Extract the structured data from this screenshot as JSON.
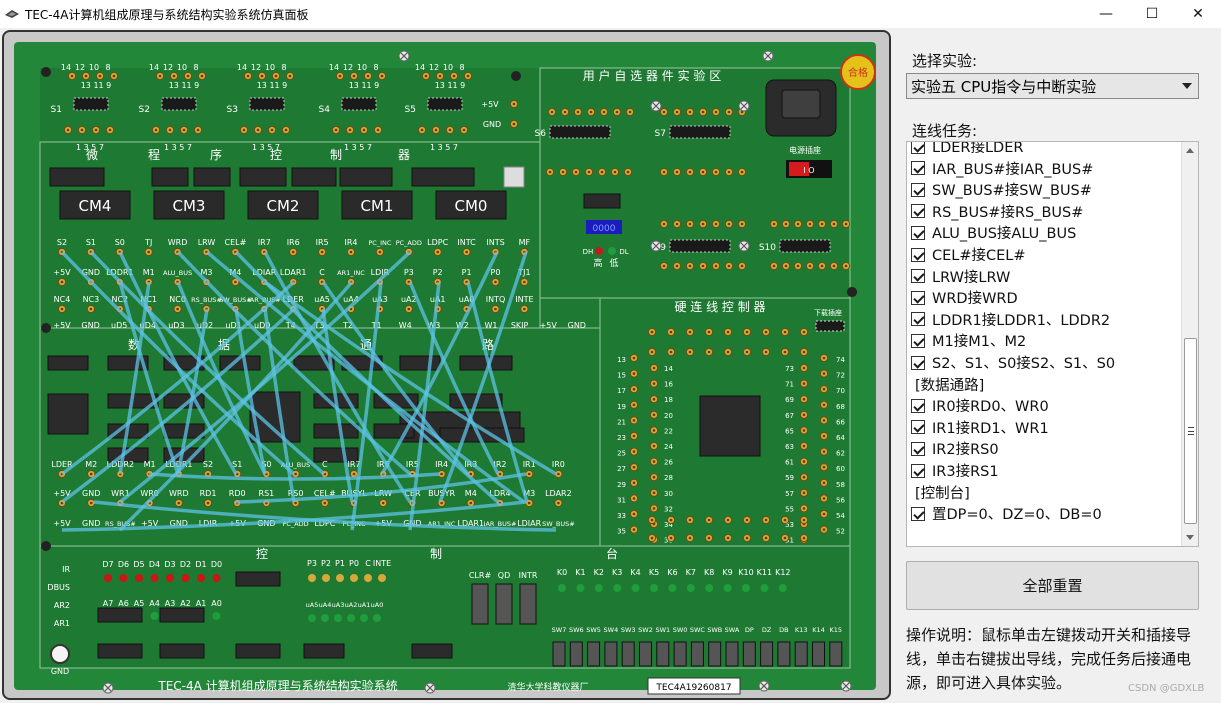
{
  "window": {
    "title": "TEC-4A计算机组成原理与系统结构实验系统仿真面板",
    "minimize": "—",
    "maximize": "☐",
    "close": "✕"
  },
  "panel": {
    "experiment_label": "选择实验:",
    "experiment_selected": "实验五  CPU指令与中断实验",
    "tasks_label": "连线任务:",
    "tasks": [
      {
        "text": "LDER接LDER",
        "checked": true
      },
      {
        "text": "IAR_BUS#接IAR_BUS#",
        "checked": true
      },
      {
        "text": "SW_BUS#接SW_BUS#",
        "checked": true
      },
      {
        "text": "RS_BUS#接RS_BUS#",
        "checked": true
      },
      {
        "text": "ALU_BUS接ALU_BUS",
        "checked": true
      },
      {
        "text": "CEL#接CEL#",
        "checked": true
      },
      {
        "text": "LRW接LRW",
        "checked": true
      },
      {
        "text": "WRD接WRD",
        "checked": true
      },
      {
        "text": "LDDR1接LDDR1、LDDR2",
        "checked": true
      },
      {
        "text": "M1接M1、M2",
        "checked": true
      },
      {
        "text": "S2、S1、S0接S2、S1、S0",
        "checked": true
      },
      {
        "header": "[数据通路]"
      },
      {
        "text": "IR0接RD0、WR0",
        "checked": true
      },
      {
        "text": "IR1接RD1、WR1",
        "checked": true
      },
      {
        "text": "IR2接RS0",
        "checked": true
      },
      {
        "text": "IR3接RS1",
        "checked": true
      },
      {
        "header": "[控制台]"
      },
      {
        "text": "置DP=0、DZ=0、DB=0",
        "checked": true
      }
    ],
    "reset_label": "全部重置",
    "help_text": "操作说明：鼠标单击左键拨动开关和插接导线，单击右键拔出导线，完成任务后接通电源，即可进入具体实验。"
  },
  "board": {
    "cm_labels": [
      "CM4",
      "CM3",
      "CM2",
      "CM1",
      "CM0"
    ],
    "section_micro": [
      "微",
      "程",
      "序",
      "控",
      "制",
      "器"
    ],
    "section_data": [
      "数",
      "据",
      "通",
      "路"
    ],
    "section_control": [
      "控",
      "制",
      "台"
    ],
    "section_user": "用 户 自 选 器 件 实 验 区",
    "section_hardwire": "硬 连 线 控 制 器",
    "pass_badge": "合格",
    "power_label": "电源插座",
    "download_label": "下载插座",
    "switch_labels": [
      "S1",
      "S2",
      "S3",
      "S4",
      "S5",
      "S6",
      "S7",
      "S8",
      "S9",
      "S10"
    ],
    "micro_sig_row1": [
      "S2",
      "S1",
      "S0",
      "TJ",
      "WRD",
      "LRW",
      "CEL#",
      "IR7",
      "IR6",
      "IR5",
      "IR4",
      "PC_INC",
      "PC_ADD",
      "LDPC",
      "INTC",
      "INTS",
      "MF"
    ],
    "micro_sig_row2": [
      "+5V",
      "GND",
      "LDDR1",
      "M1",
      "ALU_BUS",
      "M3",
      "M4",
      "LDIAR",
      "LDAR1",
      "C",
      "AR1_INC",
      "LDIR",
      "P3",
      "P2",
      "P1",
      "P0",
      "TJ1"
    ],
    "micro_sig_row3": [
      "NC4",
      "NC3",
      "NC2",
      "NC1",
      "NC0",
      "RS_BUS#",
      "SW_BUS#",
      "IAR_BUS#",
      "LDER",
      "uA5",
      "uA4",
      "uA3",
      "uA2",
      "uA1",
      "uA0",
      "INTQ",
      "INTE"
    ],
    "micro_sig_row4": [
      "+5V",
      "GND",
      "uD5",
      "uD4",
      "uD3",
      "uD2",
      "uD1",
      "uD0",
      "T4",
      "T3",
      "T2",
      "T1",
      "W4",
      "W3",
      "W2",
      "W1",
      "SKIP",
      "+5V",
      "GND"
    ],
    "data_sig_row1": [
      "LDER",
      "M2",
      "LDDR2",
      "M1",
      "LDDR1",
      "S2",
      "S1",
      "S0",
      "ALU_BUS",
      "C",
      "IR7",
      "IR6",
      "IR5",
      "IR4",
      "IR3",
      "IR2",
      "IR1",
      "IR0"
    ],
    "data_sig_row2": [
      "+5V",
      "GND",
      "WR1",
      "WR0",
      "WRD",
      "RD1",
      "RD0",
      "RS1",
      "RS0",
      "CEL#",
      "BUSYL",
      "LRW",
      "CER",
      "BUSYR",
      "M4",
      "LDR4",
      "M3",
      "LDAR2"
    ],
    "data_sig_row3": [
      "+5V",
      "GND",
      "RS_BUS#",
      "+5V",
      "GND",
      "LDIR",
      "+5V",
      "GND",
      "PC_ADD",
      "LDPC",
      "PC_INC",
      "+5V",
      "GND",
      "AR1_INC",
      "LDAR1",
      "IAR_BUS#",
      "LDIAR",
      "SW_BUS#"
    ],
    "console_leds": [
      "D7",
      "D6",
      "D5",
      "D4",
      "D3",
      "D2",
      "D1",
      "D0"
    ],
    "console_addr": [
      "A7",
      "A6",
      "A5",
      "A4",
      "A3",
      "A2",
      "A1",
      "A0"
    ],
    "console_left": [
      "IR",
      "DBUS",
      "AR2",
      "AR1"
    ],
    "console_p": [
      "P3",
      "P2",
      "P1",
      "P0",
      "C",
      "INTE"
    ],
    "console_ua": [
      "uA5",
      "uA4",
      "uA3",
      "uA2",
      "uA1",
      "uA0"
    ],
    "console_btns": [
      "CLR#",
      "QD",
      "INTR"
    ],
    "console_k": [
      "K0",
      "K1",
      "K2",
      "K3",
      "K4",
      "K5",
      "K6",
      "K7",
      "K8",
      "K9",
      "K10",
      "K11",
      "K12"
    ],
    "console_sw": [
      "SW7",
      "SW6",
      "SW5",
      "SW4",
      "SW3",
      "SW2",
      "SW1",
      "SW0",
      "SWC",
      "SWB",
      "SWA",
      "DP",
      "DZ",
      "DB",
      "K13",
      "K14",
      "K15"
    ],
    "gnd_label": "GND",
    "footer_title": "TEC-4A 计算机组成原理与系统结构实验系统",
    "footer_maker": "清华大学科教仪器厂",
    "serial": "TEC4A19260817",
    "dh": "DH",
    "dl": "DL",
    "hi": "高",
    "lo": "低",
    "led_text": "0000",
    "vcc": "+5V",
    "gnd_txt": "GND",
    "io": "I   O"
  },
  "watermark": "CSDN @GDXLB"
}
